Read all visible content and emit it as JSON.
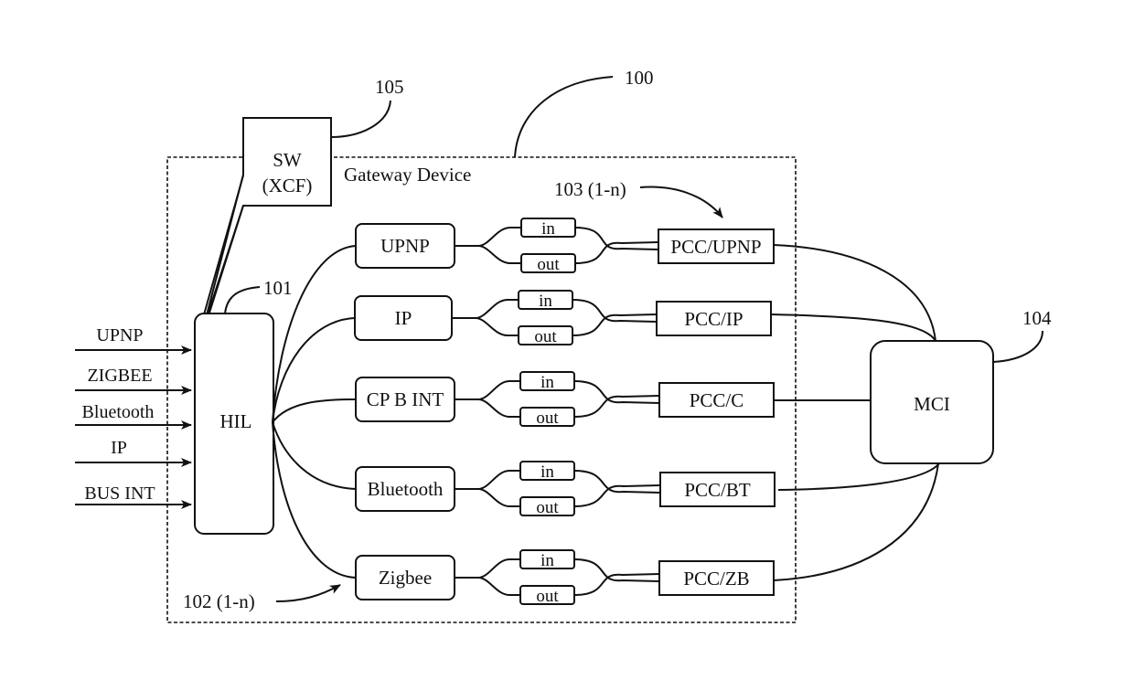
{
  "diagram": {
    "gateway": {
      "label": "Gateway Device",
      "ref": "100"
    },
    "software": {
      "line1": "SW",
      "line2": "(XCF)",
      "ref": "105"
    },
    "hil": {
      "label": "HIL",
      "ref": "101"
    },
    "inputs": [
      "UPNP",
      "ZIGBEE",
      "Bluetooth",
      "IP",
      "BUS INT"
    ],
    "protocol_ref": "102 (1-n)",
    "pcc_ref": "103 (1-n)",
    "channels": [
      {
        "protocol": "UPNP",
        "in": "in",
        "out": "out",
        "pcc": "PCC/UPNP"
      },
      {
        "protocol": "IP",
        "in": "in",
        "out": "out",
        "pcc": "PCC/IP"
      },
      {
        "protocol": "CP B INT",
        "in": "in",
        "out": "out",
        "pcc": "PCC/C"
      },
      {
        "protocol": "Bluetooth",
        "in": "in",
        "out": "out",
        "pcc": "PCC/BT"
      },
      {
        "protocol": "Zigbee",
        "in": "in",
        "out": "out",
        "pcc": "PCC/ZB"
      }
    ],
    "mci": {
      "label": "MCI",
      "ref": "104"
    }
  }
}
